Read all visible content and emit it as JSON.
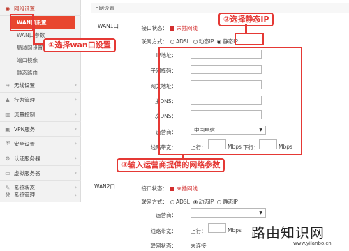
{
  "sidebar": {
    "groups": [
      {
        "label": "网络设置",
        "icon": "globe-icon"
      },
      {
        "label": "无线设置",
        "icon": "wifi-icon"
      },
      {
        "label": "行为管理",
        "icon": "user-icon"
      },
      {
        "label": "流量控制",
        "icon": "chart-icon"
      },
      {
        "label": "VPN服务",
        "icon": "vpn-icon"
      },
      {
        "label": "安全设置",
        "icon": "shield-icon"
      },
      {
        "label": "认证服务器",
        "icon": "server-icon"
      },
      {
        "label": "虚拟服务器",
        "icon": "monitor-icon"
      },
      {
        "label": "系统状态",
        "icon": "status-icon"
      },
      {
        "label": "系统管理",
        "icon": "wrench-icon"
      }
    ],
    "sub_items": [
      "WAN口设置",
      "WAN口参数",
      "局域网设置",
      "端口镜像",
      "静态路由"
    ]
  },
  "breadcrumb": "上网设置",
  "wan1": {
    "title": "WAN1口",
    "status_label": "接口状态：",
    "status_value": "未插网线",
    "mode_label": "联网方式：",
    "mode_options": [
      "ADSL",
      "动态IP",
      "静态IP"
    ],
    "fields": [
      {
        "label": "IP地址：",
        "value": ""
      },
      {
        "label": "子网掩码：",
        "value": ""
      },
      {
        "label": "网关地址：",
        "value": ""
      },
      {
        "label": "主DNS：",
        "value": ""
      },
      {
        "label": "次DNS：",
        "value": ""
      }
    ],
    "isp_label": "运营商：",
    "isp_value": "中国电信",
    "bw_label": "线路带宽：",
    "bw_up": "上行：",
    "bw_down": "下行：",
    "bw_unit": "Mbps"
  },
  "wan2": {
    "title": "WAN2口",
    "status_label": "接口状态：",
    "status_value": "未插网线",
    "mode_label": "联网方式：",
    "mode_options": [
      "ADSL",
      "动态IP",
      "静态IP"
    ],
    "isp_label": "运营商：",
    "bw_label": "线路带宽：",
    "bw_up": "上行：",
    "bw_unit": "Mbps",
    "net_label": "联网状态：",
    "net_value": "未连接"
  },
  "callouts": {
    "one": "①选择wan口设置",
    "two": "②选择静态IP",
    "three": "③输入运营商提供的网络参数"
  },
  "watermark": {
    "title": "路由知识网",
    "url": "www.yilanbo.cn"
  },
  "colors": {
    "accent": "#e8462f",
    "callout": "#e53935",
    "status": "#d32f2f"
  }
}
